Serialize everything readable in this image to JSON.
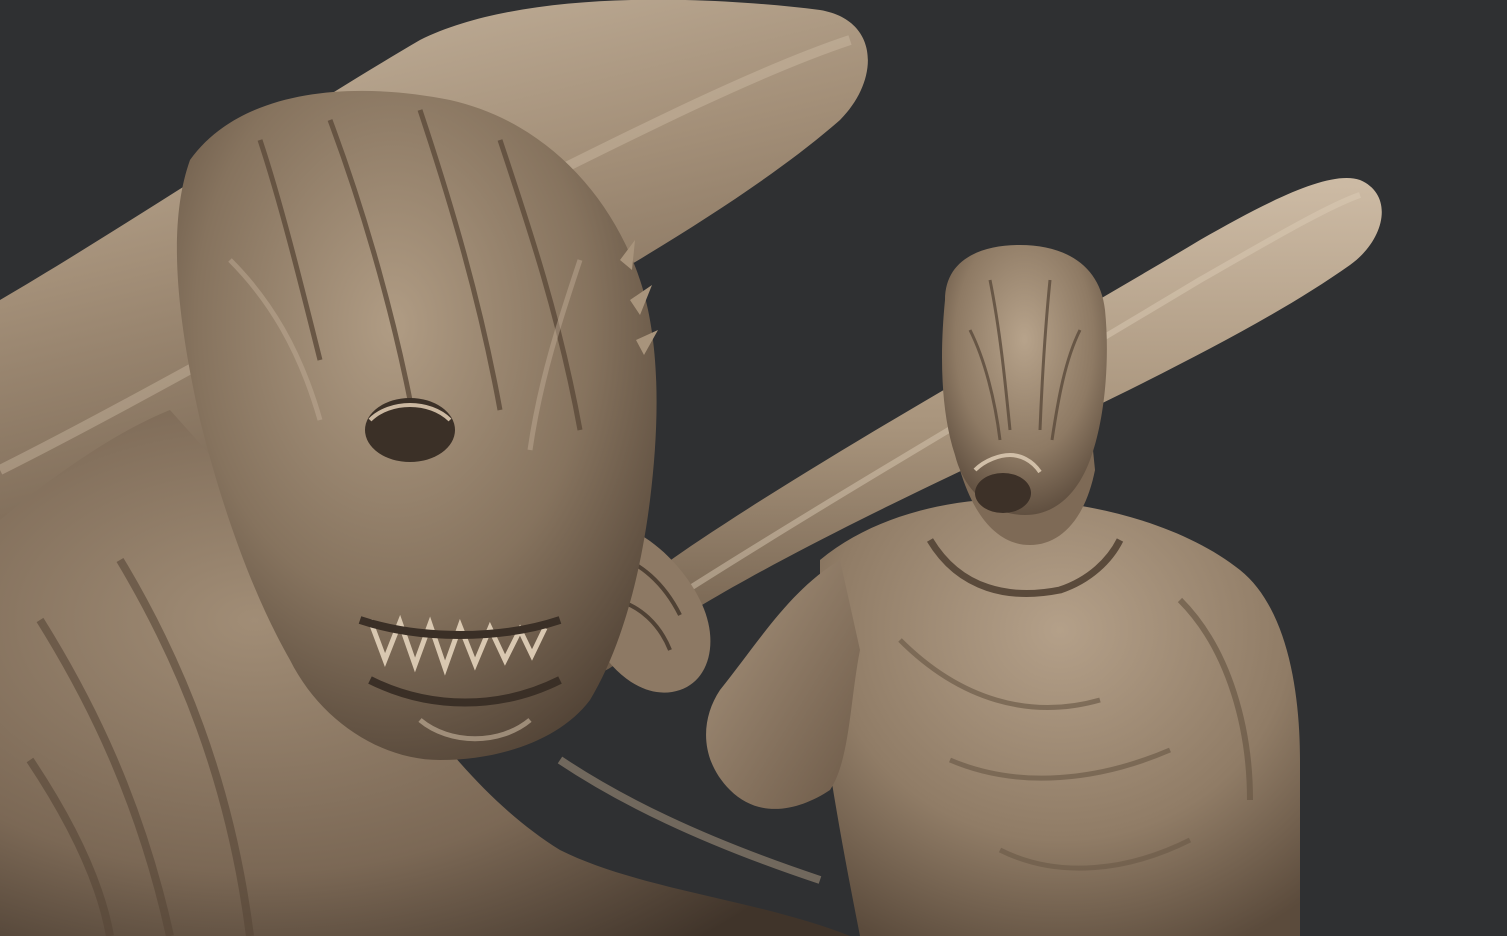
{
  "viewport": {
    "background_color": "#2f3032",
    "description_tag": "zbrush-clay-render"
  },
  "materials": {
    "clay_base": "#8c7a66",
    "clay_light": "#c4b29c",
    "clay_mid": "#9e8b75",
    "clay_shadow": "#4c3f33",
    "clay_deep": "#2e251d"
  },
  "subjects": {
    "foreground_creature": {
      "label": "creature-head-closeup"
    },
    "background_figure": {
      "label": "creature-with-bat-full"
    },
    "bat_foreground": {
      "label": "bat-closeup"
    },
    "bat_background": {
      "label": "bat-held-over-shoulder"
    }
  }
}
